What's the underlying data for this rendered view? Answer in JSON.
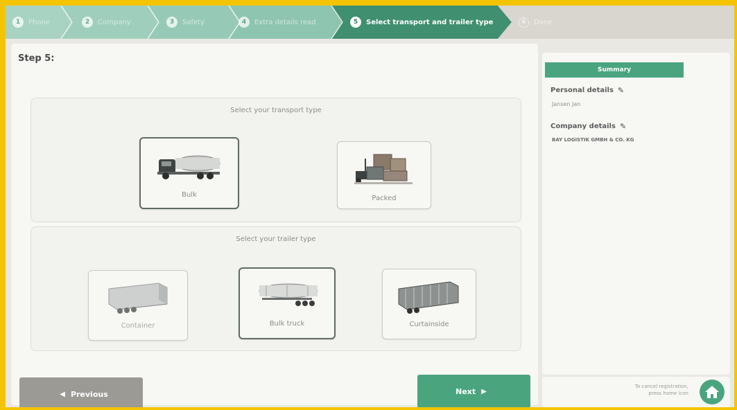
{
  "stepper": {
    "steps": [
      {
        "number": "1",
        "label": "Phone"
      },
      {
        "number": "2",
        "label": "Company"
      },
      {
        "number": "3",
        "label": "Safety"
      },
      {
        "number": "4",
        "label": "Extra details read"
      },
      {
        "number": "5",
        "label": "Select transport and trailer type"
      },
      {
        "number": "6",
        "label": "Done"
      }
    ],
    "active_step": 5
  },
  "main": {
    "step_title": "Step 5:",
    "transport": {
      "title": "Select your transport type",
      "options": [
        {
          "label": "Bulk",
          "icon": "tanker-truck-icon",
          "selected": true
        },
        {
          "label": "Packed",
          "icon": "packed-goods-icon",
          "selected": false
        }
      ]
    },
    "trailer": {
      "title": "Select your trailer type",
      "options": [
        {
          "label": "Container",
          "icon": "container-trailer-icon",
          "selected": false
        },
        {
          "label": "Bulk truck",
          "icon": "bulk-trailer-icon",
          "selected": true
        },
        {
          "label": "Curtainside",
          "icon": "curtainside-trailer-icon",
          "selected": false
        }
      ]
    },
    "previous_label": "Previous",
    "next_label": "Next"
  },
  "summary": {
    "title": "Summary",
    "personal_heading": "Personal details",
    "personal_value": "Jansen Jan",
    "company_heading": "Company details",
    "company_value": "BAY LOGISTIK GMBH & CO. KG"
  },
  "footer": {
    "cancel_line1": "To cancel registration,",
    "cancel_line2": "press home icon",
    "home_icon": "home-icon"
  },
  "colors": {
    "frame": "#f5c400",
    "accent": "#4aa57f",
    "step_done": "#8fc7b1",
    "step_active": "#3f8f70"
  }
}
